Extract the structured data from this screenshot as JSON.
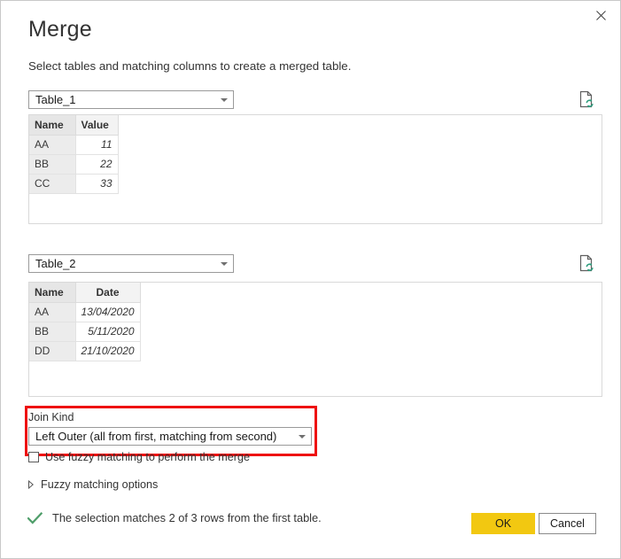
{
  "dialog": {
    "title": "Merge",
    "subtitle": "Select tables and matching columns to create a merged table.",
    "close_icon": "close-icon"
  },
  "first_table": {
    "selected": "Table_1",
    "refresh_icon": "refresh-preview-icon",
    "columns": [
      "Name",
      "Value"
    ],
    "selected_column": "Name",
    "rows": [
      {
        "name": "AA",
        "value": "11"
      },
      {
        "name": "BB",
        "value": "22"
      },
      {
        "name": "CC",
        "value": "33"
      }
    ]
  },
  "second_table": {
    "selected": "Table_2",
    "refresh_icon": "refresh-preview-icon",
    "columns": [
      "Name",
      "Date"
    ],
    "selected_column": "Name",
    "rows": [
      {
        "name": "AA",
        "value": "13/04/2020"
      },
      {
        "name": "BB",
        "value": "5/11/2020"
      },
      {
        "name": "DD",
        "value": "21/10/2020"
      }
    ]
  },
  "join_kind": {
    "label": "Join Kind",
    "selected": "Left Outer (all from first, matching from second)",
    "highlight_color": "#ee1111"
  },
  "fuzzy": {
    "checkbox_label": "Use fuzzy matching to perform the merge",
    "checked": false,
    "options_label": "Fuzzy matching options",
    "expanded": false
  },
  "status": {
    "icon": "check-icon",
    "icon_color": "#4f9e6a",
    "text": "The selection matches 2 of 3 rows from the first table."
  },
  "footer": {
    "ok_label": "OK",
    "ok_color": "#f2c811",
    "cancel_label": "Cancel"
  }
}
